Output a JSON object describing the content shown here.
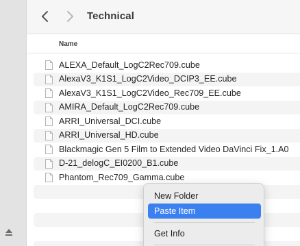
{
  "window": {
    "title": "Technical"
  },
  "toolbar": {
    "back_icon": "chevron-left-icon",
    "forward_icon": "chevron-right-icon"
  },
  "list": {
    "column_header": "Name",
    "files": [
      "ALEXA_Default_LogC2Rec709.cube",
      "AlexaV3_K1S1_LogC2Video_DCIP3_EE.cube",
      "AlexaV3_K1S1_LogC2Video_Rec709_EE.cube",
      "AMIRA_Default_LogC2Rec709.cube",
      "ARRI_Universal_DCI.cube",
      "ARRI_Universal_HD.cube",
      "Blackmagic Gen 5 Film to Extended Video DaVinci Fix_1.A0",
      "D-21_delogC_EI0200_B1.cube",
      "Phantom_Rec709_Gamma.cube"
    ]
  },
  "context_menu": {
    "items": [
      "New Folder",
      "Paste Item",
      "Get Info"
    ],
    "selected": "Paste Item"
  },
  "colors": {
    "accent": "#3b80f0",
    "sidebar": "#e3e3e3",
    "row_alt": "#f4f4f4"
  }
}
